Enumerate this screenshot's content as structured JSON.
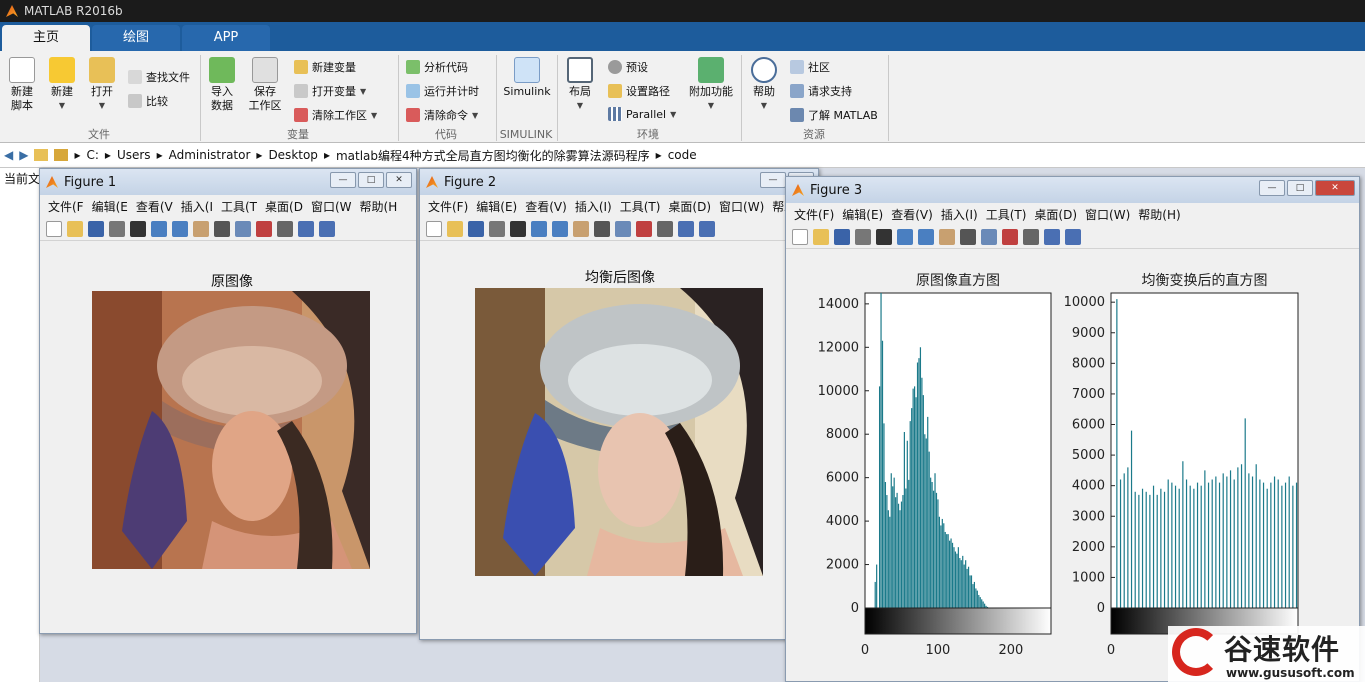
{
  "app": {
    "title": "MATLAB R2016b"
  },
  "tabs": [
    {
      "label": "主页"
    },
    {
      "label": "绘图"
    },
    {
      "label": "APP"
    }
  ],
  "ribbon": {
    "new_script": "新建\n脚本",
    "new": "新建",
    "open": "打开",
    "find_files": "查找文件",
    "compare": "比较",
    "import_data": "导入\n数据",
    "save_workspace": "保存\n工作区",
    "new_variable": "新建变量",
    "open_variable": "打开变量",
    "clear_workspace": "清除工作区",
    "analyze_code": "分析代码",
    "run_and_time": "运行并计时",
    "clear_commands": "清除命令",
    "simulink": "Simulink",
    "layout": "布局",
    "preferences": "预设",
    "set_path": "设置路径",
    "parallel": "Parallel",
    "addons": "附加功能",
    "help": "帮助",
    "community": "社区",
    "request_support": "请求支持",
    "learn_matlab": "了解 MATLAB",
    "groups": {
      "file": "文件",
      "variable": "变量",
      "code": "代码",
      "simulink": "SIMULINK",
      "environment": "环境",
      "resources": "资源"
    }
  },
  "address": {
    "path": [
      "C:",
      "Users",
      "Administrator",
      "Desktop",
      "matlab编程4种方式全局直方图均衡化的除雾算法源码程序",
      "code"
    ]
  },
  "left_panel": {
    "label": "当前文"
  },
  "figure1": {
    "title": "Figure 1",
    "menu": [
      "文件(F",
      "编辑(E",
      "查看(V",
      "插入(I",
      "工具(T",
      "桌面(D",
      "窗口(W",
      "帮助(H"
    ],
    "image_title": "原图像"
  },
  "figure2": {
    "title": "Figure 2",
    "menu": [
      "文件(F)",
      "编辑(E)",
      "查看(V)",
      "插入(I)",
      "工具(T)",
      "桌面(D)",
      "窗口(W)",
      "帮助("
    ],
    "image_title": "均衡后图像"
  },
  "figure3": {
    "title": "Figure 3",
    "menu": [
      "文件(F)",
      "编辑(E)",
      "查看(V)",
      "插入(I)",
      "工具(T)",
      "桌面(D)",
      "窗口(W)",
      "帮助(H)"
    ]
  },
  "chart_data": [
    {
      "type": "bar",
      "title": "原图像直方图",
      "ylim": [
        0,
        14500
      ],
      "xlim": [
        0,
        255
      ],
      "y_ticks": [
        0,
        2000,
        4000,
        6000,
        8000,
        10000,
        12000,
        14000
      ],
      "x_ticks": [
        0,
        100,
        200
      ],
      "colorbar": "grayscale",
      "color": "#1b7a8a",
      "x": [
        14,
        16,
        20,
        22,
        24,
        26,
        28,
        30,
        32,
        34,
        36,
        38,
        40,
        42,
        44,
        46,
        48,
        50,
        52,
        54,
        56,
        58,
        60,
        62,
        64,
        66,
        68,
        70,
        72,
        74,
        76,
        78,
        80,
        82,
        84,
        86,
        88,
        90,
        92,
        94,
        96,
        98,
        100,
        102,
        104,
        106,
        108,
        110,
        112,
        114,
        116,
        118,
        120,
        122,
        124,
        126,
        128,
        130,
        132,
        134,
        136,
        138,
        140,
        142,
        144,
        146,
        148,
        150,
        152,
        154,
        156,
        158,
        160,
        162,
        164,
        166,
        168,
        170,
        172,
        174,
        176,
        178,
        180,
        182,
        184,
        186,
        188,
        190,
        192,
        194,
        196,
        198,
        200,
        202
      ],
      "values": [
        1200,
        2000,
        10200,
        14500,
        12300,
        8500,
        5800,
        5200,
        4500,
        4200,
        6200,
        5600,
        6000,
        5100,
        5300,
        4800,
        4500,
        4900,
        5200,
        8100,
        5500,
        7700,
        5900,
        8600,
        9200,
        10100,
        10200,
        9700,
        11300,
        11500,
        12000,
        10600,
        9800,
        8000,
        7800,
        8800,
        7200,
        6000,
        5800,
        5400,
        6200,
        5300,
        5000,
        4200,
        3800,
        4100,
        3900,
        3500,
        3400,
        3400,
        3100,
        3200,
        3000,
        2800,
        2600,
        2500,
        2800,
        2300,
        2200,
        2400,
        2000,
        2200,
        1800,
        1900,
        1500,
        1500,
        1100,
        1200,
        900,
        800,
        600,
        500,
        400,
        300,
        200,
        100,
        50,
        0,
        0,
        0,
        0,
        0,
        0,
        0,
        0,
        0,
        0,
        0,
        0,
        0,
        0,
        0,
        0,
        0
      ]
    },
    {
      "type": "bar",
      "title": "均衡变换后的直方图",
      "ylim": [
        0,
        10300
      ],
      "xlim": [
        0,
        255
      ],
      "y_ticks": [
        0,
        1000,
        2000,
        3000,
        4000,
        5000,
        6000,
        7000,
        8000,
        9000,
        10000
      ],
      "x_ticks": [
        0
      ],
      "colorbar": "grayscale",
      "color": "#1b7a8a",
      "x": [
        8,
        13,
        18,
        23,
        28,
        33,
        38,
        43,
        48,
        53,
        58,
        63,
        68,
        73,
        78,
        83,
        88,
        93,
        98,
        103,
        108,
        113,
        118,
        123,
        128,
        133,
        138,
        143,
        148,
        153,
        158,
        163,
        168,
        173,
        178,
        183,
        188,
        193,
        198,
        203,
        208,
        213,
        218,
        223,
        228,
        233,
        238,
        243,
        248,
        253
      ],
      "values": [
        10100,
        4200,
        4400,
        4600,
        5800,
        3800,
        3700,
        3900,
        3800,
        3700,
        4000,
        3700,
        3900,
        3800,
        4200,
        4100,
        4000,
        3900,
        4800,
        4200,
        4000,
        3900,
        4100,
        4000,
        4500,
        4100,
        4200,
        4300,
        4100,
        4400,
        4300,
        4500,
        4200,
        4600,
        4700,
        6200,
        4400,
        4300,
        4700,
        4200,
        4100,
        3900,
        4100,
        4300,
        4200,
        4000,
        4100,
        4300,
        4000,
        4100
      ]
    }
  ],
  "watermark": {
    "name": "谷速软件",
    "url": "www.gususoft.com"
  }
}
